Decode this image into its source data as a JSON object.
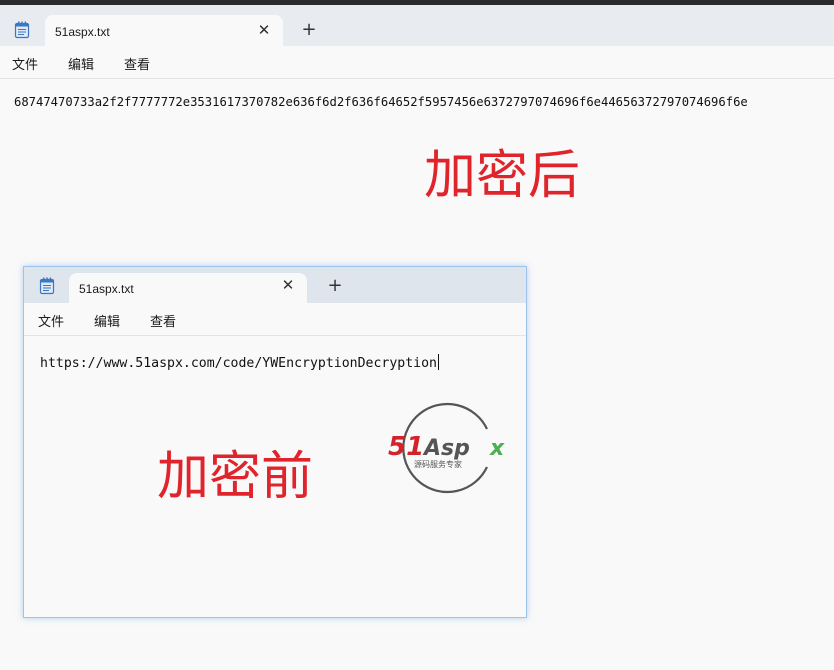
{
  "outer_window": {
    "tab_title": "51aspx.txt",
    "menu": [
      "文件",
      "编辑",
      "查看"
    ],
    "content": "68747470733a2f2f7777772e3531617370782e636f6d2f636f64652f5957456e6372797074696f6e44656372797074696f6e",
    "label": "加密后"
  },
  "inner_window": {
    "tab_title": "51aspx.txt",
    "menu": [
      "文件",
      "编辑",
      "查看"
    ],
    "content": "https://www.51aspx.com/code/YWEncryptionDecryption",
    "label": "加密前"
  },
  "logo": {
    "brand": "51Aspx",
    "tagline": "源码服务专家"
  },
  "colors": {
    "label_red": "#e0242b",
    "logo_red": "#d3232a",
    "logo_green": "#4caf50",
    "logo_gray": "#555555"
  },
  "icons": {
    "app": "notepad-icon",
    "close": "close-icon",
    "new_tab": "plus-icon"
  }
}
